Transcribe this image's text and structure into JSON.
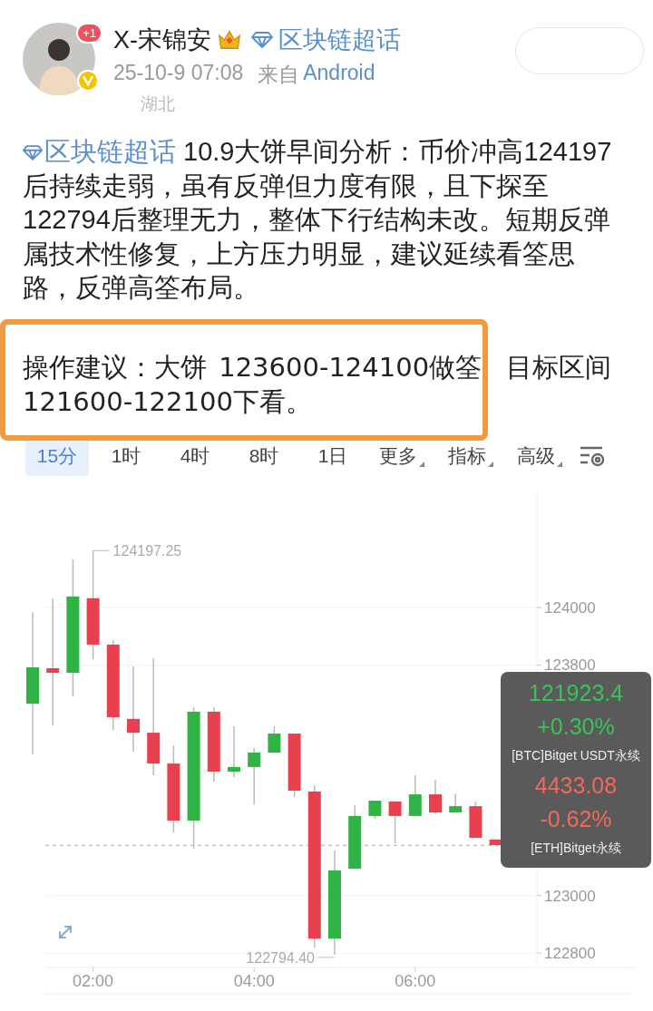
{
  "post": {
    "author": "X-宋锦安",
    "avatar_badge": "+1",
    "topic_tag": "区块链超话",
    "time": "25-10-9 07:08",
    "source_prefix": "来自",
    "source": "Android",
    "location": "湖北"
  },
  "body": {
    "topic": "区块链超话",
    "text": " 10.9大饼早间分析：币价冲高124197后持续走弱，虽有反弹但力度有限，且下探至122794后整理无力，整体下行结构未改。短期反弹属技术性修复，上方压力明显，建议延续看筌思路，反弹高筌布局。"
  },
  "advice": {
    "text": "操作建议：大饼 123600-124100做筌  目标区间121600-122100下看。",
    "highlighted": true
  },
  "tabs": [
    {
      "label": "15分",
      "selected": true,
      "dropdown": false
    },
    {
      "label": "1时",
      "selected": false,
      "dropdown": false
    },
    {
      "label": "4时",
      "selected": false,
      "dropdown": false
    },
    {
      "label": "8时",
      "selected": false,
      "dropdown": false
    },
    {
      "label": "1日",
      "selected": false,
      "dropdown": false
    },
    {
      "label": "更多",
      "selected": false,
      "dropdown": true
    },
    {
      "label": "指标",
      "selected": false,
      "dropdown": true
    },
    {
      "label": "高级",
      "selected": false,
      "dropdown": true
    }
  ],
  "chart": {
    "chart_data": {
      "type": "candlestick",
      "categories": [
        null,
        null,
        null,
        "02:00",
        null,
        null,
        null,
        null,
        null,
        null,
        null,
        "04:00",
        null,
        null,
        null,
        null,
        null,
        null,
        null,
        "06:00",
        null,
        null,
        null,
        null
      ],
      "ohlc": [
        [
          123666,
          123984,
          123490,
          123792
        ],
        [
          123789,
          124032,
          123591,
          123773
        ],
        [
          123773,
          124167,
          123691,
          124038
        ],
        [
          124032,
          124197.25,
          123820,
          123871
        ],
        [
          123871,
          123887,
          123575,
          123619
        ],
        [
          123613,
          123795,
          123499,
          123565
        ],
        [
          123565,
          123824,
          123417,
          123458
        ],
        [
          123458,
          123521,
          123219,
          123260
        ],
        [
          123260,
          123654,
          123162,
          123638
        ],
        [
          123638,
          123654,
          123395,
          123430
        ],
        [
          123430,
          123587,
          123411,
          123446
        ],
        [
          123446,
          123512,
          123316,
          123496
        ],
        [
          123496,
          123587,
          123496,
          123562
        ],
        [
          123562,
          123562,
          123342,
          123364
        ],
        [
          123361,
          123383,
          122819,
          122850
        ],
        [
          122850,
          123156,
          122794.4,
          123087
        ],
        [
          123093,
          123313,
          123093,
          123276
        ],
        [
          123276,
          123329,
          123266,
          123329
        ],
        [
          123326,
          123326,
          123181,
          123276
        ],
        [
          123276,
          123417,
          123276,
          123351
        ],
        [
          123351,
          123402,
          123282,
          123288
        ],
        [
          123288,
          123354,
          123288,
          123310
        ],
        [
          123310,
          123326,
          123200,
          123200
        ],
        [
          123194,
          123194,
          123175,
          123175
        ]
      ],
      "ylim": [
        122750,
        124409
      ],
      "yticks": [
        124000,
        123800,
        123000,
        122800
      ],
      "grid": true,
      "annotations": [
        "124197.25",
        "122794.40"
      ],
      "ref_lines": [
        {
          "axis": "y",
          "value": 123174
        }
      ]
    },
    "tickers": [
      {
        "price": "121923.4",
        "change": "+0.30%",
        "color": "#37c455",
        "name": "[BTC]Bitget USDT永续"
      },
      {
        "price": "4433.08",
        "change": "-0.62%",
        "color": "#f06a5a",
        "name": "[ETH]Bitget永续"
      }
    ]
  }
}
